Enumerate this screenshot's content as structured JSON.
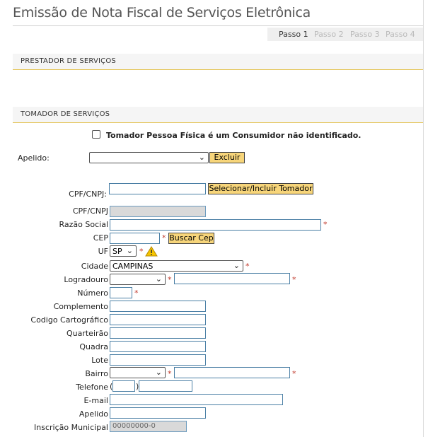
{
  "page": {
    "title": "Emissão de Nota Fiscal de Serviços Eletrônica"
  },
  "steps": [
    {
      "label": "Passo 1",
      "active": true
    },
    {
      "label": "Passo 2",
      "active": false
    },
    {
      "label": "Passo 3",
      "active": false
    },
    {
      "label": "Passo 4",
      "active": false
    }
  ],
  "sections": {
    "prestador": "PRESTADOR DE SERVIÇOS",
    "tomador": "TOMADOR DE SERVIÇOS"
  },
  "consumer_checkbox": {
    "label": "Tomador Pessoa Física é um Consumidor não identificado.",
    "checked": false
  },
  "apelido_select": {
    "label": "Apelido:",
    "value": ""
  },
  "buttons": {
    "excluir": "Excluir",
    "selecionar": "Selecionar/Incluir Tomador",
    "buscar_cep": "Buscar Cep"
  },
  "fields": {
    "cpf_cnpj_search": {
      "label": "CPF/CNPJ:",
      "value": ""
    },
    "cpf_cnpj": {
      "label": "CPF/CNPJ",
      "value": ""
    },
    "razao_social": {
      "label": "Razão Social",
      "value": ""
    },
    "cep": {
      "label": "CEP",
      "value": ""
    },
    "uf": {
      "label": "UF",
      "value": "SP"
    },
    "cidade": {
      "label": "Cidade",
      "value": "CAMPINAS"
    },
    "logradouro": {
      "label": "Logradouro",
      "value": ""
    },
    "numero": {
      "label": "Número",
      "value": ""
    },
    "complemento": {
      "label": "Complemento",
      "value": ""
    },
    "codigo_cartografico": {
      "label": "Codigo Cartográfico",
      "value": ""
    },
    "quarteirao": {
      "label": "Quarteirão",
      "value": ""
    },
    "quadra": {
      "label": "Quadra",
      "value": ""
    },
    "lote": {
      "label": "Lote",
      "value": ""
    },
    "bairro": {
      "label": "Bairro",
      "value": ""
    },
    "telefone": {
      "label": "Telefone",
      "open_paren": "(",
      "close_paren": ")"
    },
    "email": {
      "label": "E-mail",
      "value": ""
    },
    "apelido": {
      "label": "Apelido",
      "value": ""
    },
    "inscricao_municipal": {
      "label": "Inscrição Municipal",
      "value": "00000000-0"
    }
  },
  "required_marker": "*",
  "icons": {
    "warning": "warning-icon",
    "chevron": "chevron-down-icon",
    "checkbox": "checkbox-icon"
  },
  "colors": {
    "section_rule": "#e3c24e",
    "button_bg": "#f7d57a",
    "input_border": "#4a7fa5",
    "required": "#c0392b"
  }
}
